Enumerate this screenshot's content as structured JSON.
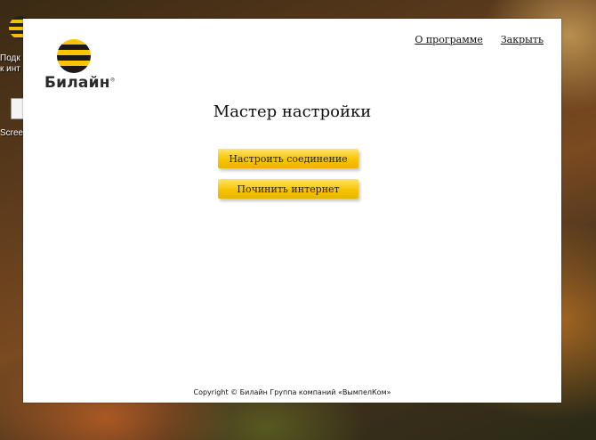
{
  "desktop": {
    "icons": [
      {
        "label_line1": "Подк",
        "label_line2": "к инт"
      },
      {
        "label_line1": "Scree"
      }
    ]
  },
  "window": {
    "logo": {
      "brand": "Билайн",
      "reg_mark": "®"
    },
    "links": {
      "about": "О программе",
      "close": "Закрыть"
    },
    "title": "Мастер настройки",
    "buttons": {
      "setup_connection": "Настроить соединение",
      "repair_internet": "Починить интернет"
    },
    "footer": {
      "copyright": "Copyright © Билайн Группа компаний «ВымпелКом»"
    }
  },
  "colors": {
    "brand_yellow": "#f7c500",
    "brand_black": "#1a1a1a"
  }
}
